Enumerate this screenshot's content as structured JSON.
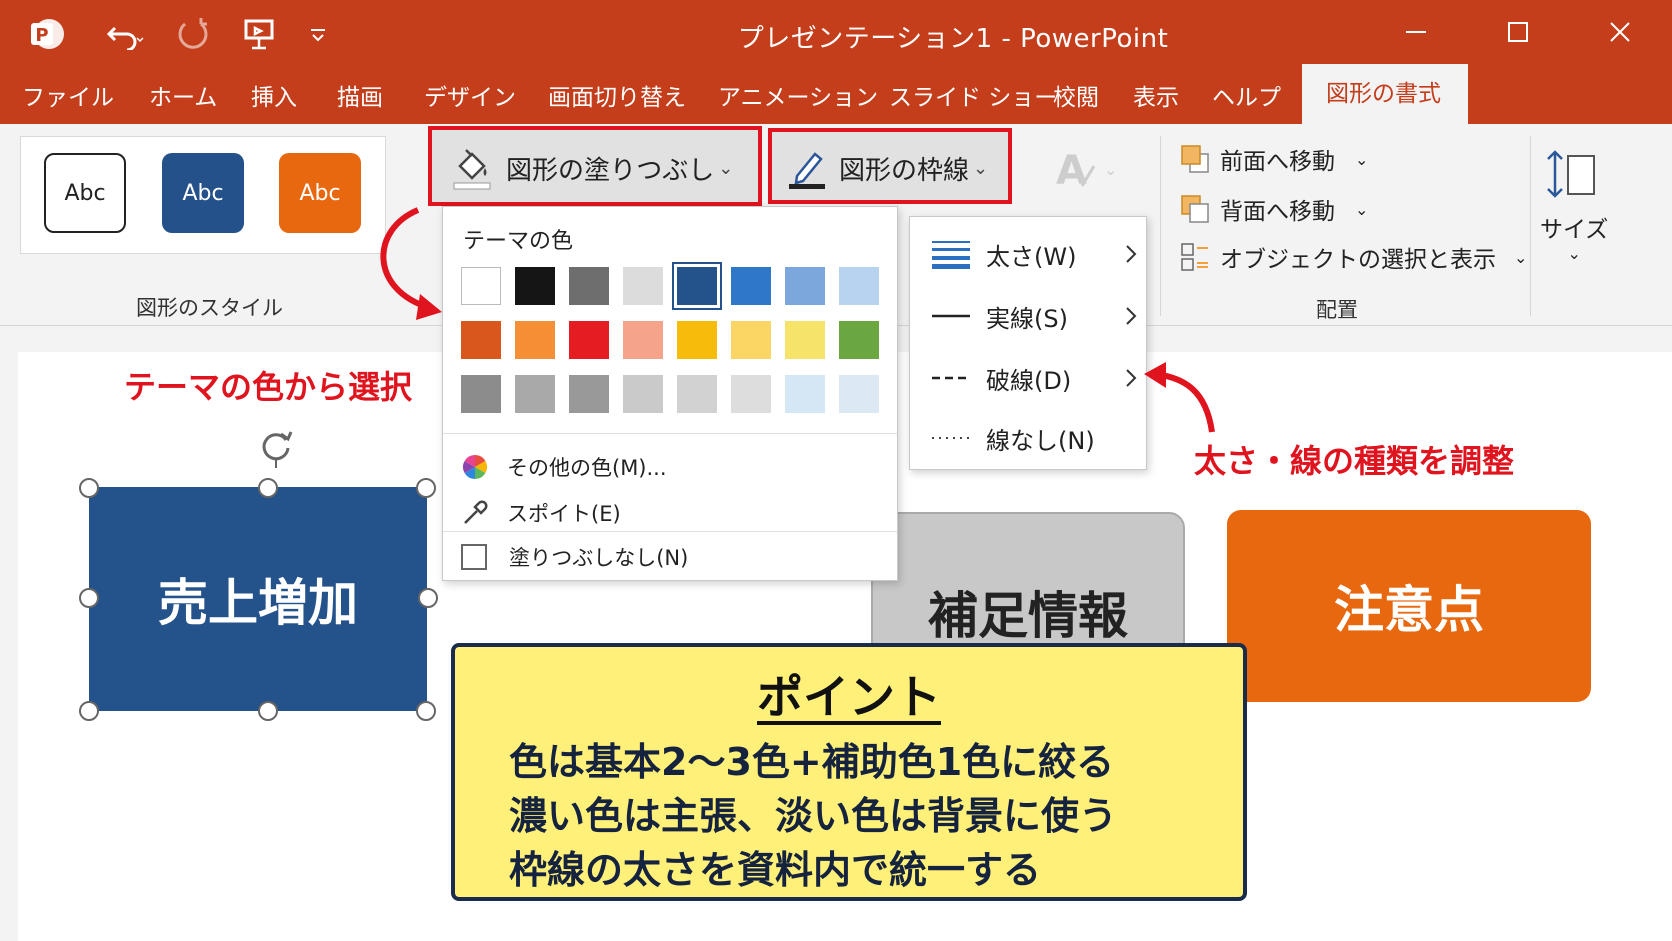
{
  "window": {
    "title": "プレゼンテーション1  -  PowerPoint",
    "app_icon": "powerpoint-logo-icon",
    "quick_access": [
      "undo-icon",
      "redo-icon",
      "present-icon",
      "customize-chevron-icon"
    ],
    "controls": [
      "minimize-icon",
      "maximize-icon",
      "close-icon"
    ]
  },
  "tabs": [
    {
      "label": "ファイル"
    },
    {
      "label": "ホーム"
    },
    {
      "label": "挿入"
    },
    {
      "label": "描画"
    },
    {
      "label": "デザイン"
    },
    {
      "label": "画面切り替え"
    },
    {
      "label": "アニメーション"
    },
    {
      "label": "スライド ショー"
    },
    {
      "label": "校閲"
    },
    {
      "label": "表示"
    },
    {
      "label": "ヘルプ"
    },
    {
      "label": "図形の書式",
      "active": true
    }
  ],
  "ribbon": {
    "shape_styles": {
      "label": "図形のスタイル",
      "samples": [
        {
          "text": "Abc",
          "fill": "#ffffff",
          "color": "#222222",
          "border": "#222222"
        },
        {
          "text": "Abc",
          "fill": "#25518b",
          "color": "#ffffff",
          "border": "#25518b"
        },
        {
          "text": "Abc",
          "fill": "#e8680f",
          "color": "#ffffff",
          "border": "#e8680f"
        }
      ]
    },
    "fill_button": {
      "label": "図形の塗りつぶし",
      "chevron": "⌄"
    },
    "outline_button": {
      "label": "図形の枠線",
      "chevron": "⌄"
    },
    "arrange": {
      "label": "配置",
      "items": [
        {
          "label": "前面へ移動",
          "chevron": "⌄"
        },
        {
          "label": "背面へ移動",
          "chevron": "⌄"
        },
        {
          "label": "オブジェクトの選択と表示",
          "chevron": "⌄"
        }
      ]
    },
    "size": {
      "label": "サイズ",
      "chevron": "⌄"
    }
  },
  "fill_menu": {
    "heading": "テーマの色",
    "colors": [
      [
        "#ffffff",
        "#151515",
        "#6e6e6e",
        "#dcdcdc",
        "#24528b",
        "#2e77c9",
        "#7ba7dd",
        "#b7d3ef"
      ],
      [
        "#d9561c",
        "#f58f35",
        "#e51c21",
        "#f5a38a",
        "#f7bb0b",
        "#fbd665",
        "#f6e36a",
        "#6aa740"
      ],
      [
        "#8c8c8c",
        "#a9a9a9",
        "#999999",
        "#cacaca",
        "#d2d2d2",
        "#dddddd",
        "#d5e6f5",
        "#dce9f5"
      ]
    ],
    "selected_color": "#24528b",
    "more_colors": "その他の色(M)...",
    "eyedropper": "スポイト(E)",
    "no_fill": "塗りつぶしなし(N)"
  },
  "outline_menu": {
    "items": [
      {
        "label": "太さ(W)",
        "icon": "line-weight-icon"
      },
      {
        "label": "実線(S)",
        "icon": "solid-line-icon"
      },
      {
        "label": "破線(D)",
        "icon": "dashed-line-icon"
      },
      {
        "label": "線なし(N)",
        "icon": "no-line-icon"
      }
    ]
  },
  "annotations": {
    "theme_colors": "テーマの色から選択",
    "line_types": "太さ・線の種類を調整"
  },
  "slide": {
    "shapes": [
      {
        "text": "売上増加",
        "fill": "#24528b"
      },
      {
        "text": "補足情報",
        "fill": "#c8c8c8"
      },
      {
        "text": "注意点",
        "fill": "#e8680f"
      }
    ],
    "point_box": {
      "title": "ポイント",
      "lines": [
        "色は基本2〜3色+補助色1色に絞る",
        "濃い色は主張、淡い色は背景に使う",
        "枠線の太さを資料内で統一する"
      ]
    }
  }
}
